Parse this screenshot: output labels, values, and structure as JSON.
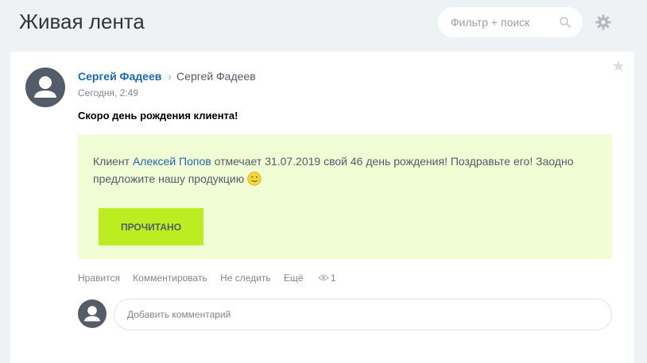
{
  "header": {
    "title": "Живая лента",
    "search_placeholder": "Фильтр + поиск"
  },
  "post": {
    "author": "Сергей Фадеев",
    "recipient": "Сергей Фадеев",
    "date": "Сегодня, 2:49",
    "title": "Скоро день рождения клиента!",
    "notice": {
      "prefix": "Клиент ",
      "client_name": "Алексей  Попов",
      "suffix": " отмечает 31.07.2019 свой 46 день рождения! Поздравьте его! Заодно предложите нашу продукцию",
      "button_label": "ПРОЧИТАНО",
      "background_color": "#f1fdd4",
      "button_color": "#bbed21"
    },
    "actions": {
      "like": "Нравится",
      "comment": "Комментировать",
      "unfollow": "Не следить",
      "more": "Ещё",
      "views": "1"
    },
    "comment_placeholder": "Добавить комментарий"
  },
  "icons": [
    "search-icon",
    "gear-icon",
    "star-icon",
    "chevron-right-icon",
    "eye-icon",
    "smiley-icon",
    "user-avatar-icon"
  ]
}
